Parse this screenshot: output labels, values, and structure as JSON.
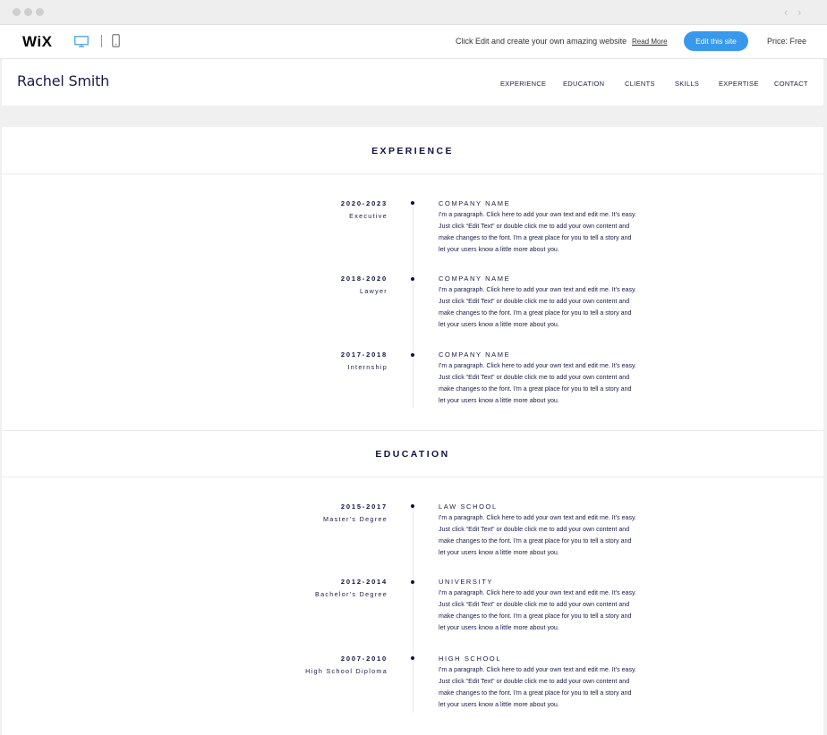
{
  "browser": {
    "back_arrow": "‹",
    "forward_arrow": "›"
  },
  "wix_bar": {
    "logo": "WiX",
    "promo_text": "Click Edit and create your own amazing website",
    "read_more": "Read More",
    "edit_button": "Edit this site",
    "price": "Price: Free",
    "icons": [
      "desktop-icon",
      "mobile-icon"
    ],
    "accent_color": "#3899ec"
  },
  "site": {
    "title": "Rachel Smith",
    "menu": [
      "EXPERIENCE",
      "EDUCATION",
      "CLIENTS",
      "SKILLS",
      "EXPERTISE",
      "CONTACT"
    ]
  },
  "experience": {
    "title": "EXPERIENCE",
    "entries": [
      {
        "years": "2020-2023",
        "role": "Executive",
        "org": "COMPANY NAME",
        "desc": "I'm a paragraph. Click here to add your own text and edit me. It's easy. Just click “Edit Text” or double click me to add your own content and make changes to the font. I'm a great place for you to tell a story and let your users know a little more about you."
      },
      {
        "years": "2018-2020",
        "role": "Lawyer",
        "org": "COMPANY NAME",
        "desc": "I'm a paragraph. Click here to add your own text and edit me. It's easy. Just click “Edit Text” or double click me to add your own content and make changes to the font. I'm a great place for you to tell a story and let your users know a little more about you."
      },
      {
        "years": "2017-2018",
        "role": "Internship",
        "org": "COMPANY NAME",
        "desc": "I'm a paragraph. Click here to add your own text and edit me. It's easy. Just click “Edit Text” or double click me to add your own content and make changes to the font. I'm a great place for you to tell a story and let your users know a little more about you."
      }
    ]
  },
  "education": {
    "title": "EDUCATION",
    "entries": [
      {
        "years": "2015-2017",
        "role": "Master's Degree",
        "org": "LAW SCHOOL",
        "desc": "I'm a paragraph. Click here to add your own text and edit me. It's easy. Just click “Edit Text” or double click me to add your own content and make changes to the font. I'm a great place for you to tell a story and let your users know a little more about you."
      },
      {
        "years": "2012-2014",
        "role": "Bachelor's Degree",
        "org": "UNIVERSITY",
        "desc": "I'm a paragraph. Click here to add your own text and edit me. It's easy. Just click “Edit Text” or double click me to add your own content and make changes to the font. I'm a great place for you to tell a story and let your users know a little more about you."
      },
      {
        "years": "2007-2010",
        "role": "High School Diploma",
        "org": "HIGH SCHOOL",
        "desc": "I'm a paragraph. Click here to add your own text and edit me. It's easy. Just click “Edit Text” or double click me to add your own content and make changes to the font. I'm a great place for you to tell a story and let your users know a little more about you."
      }
    ]
  }
}
